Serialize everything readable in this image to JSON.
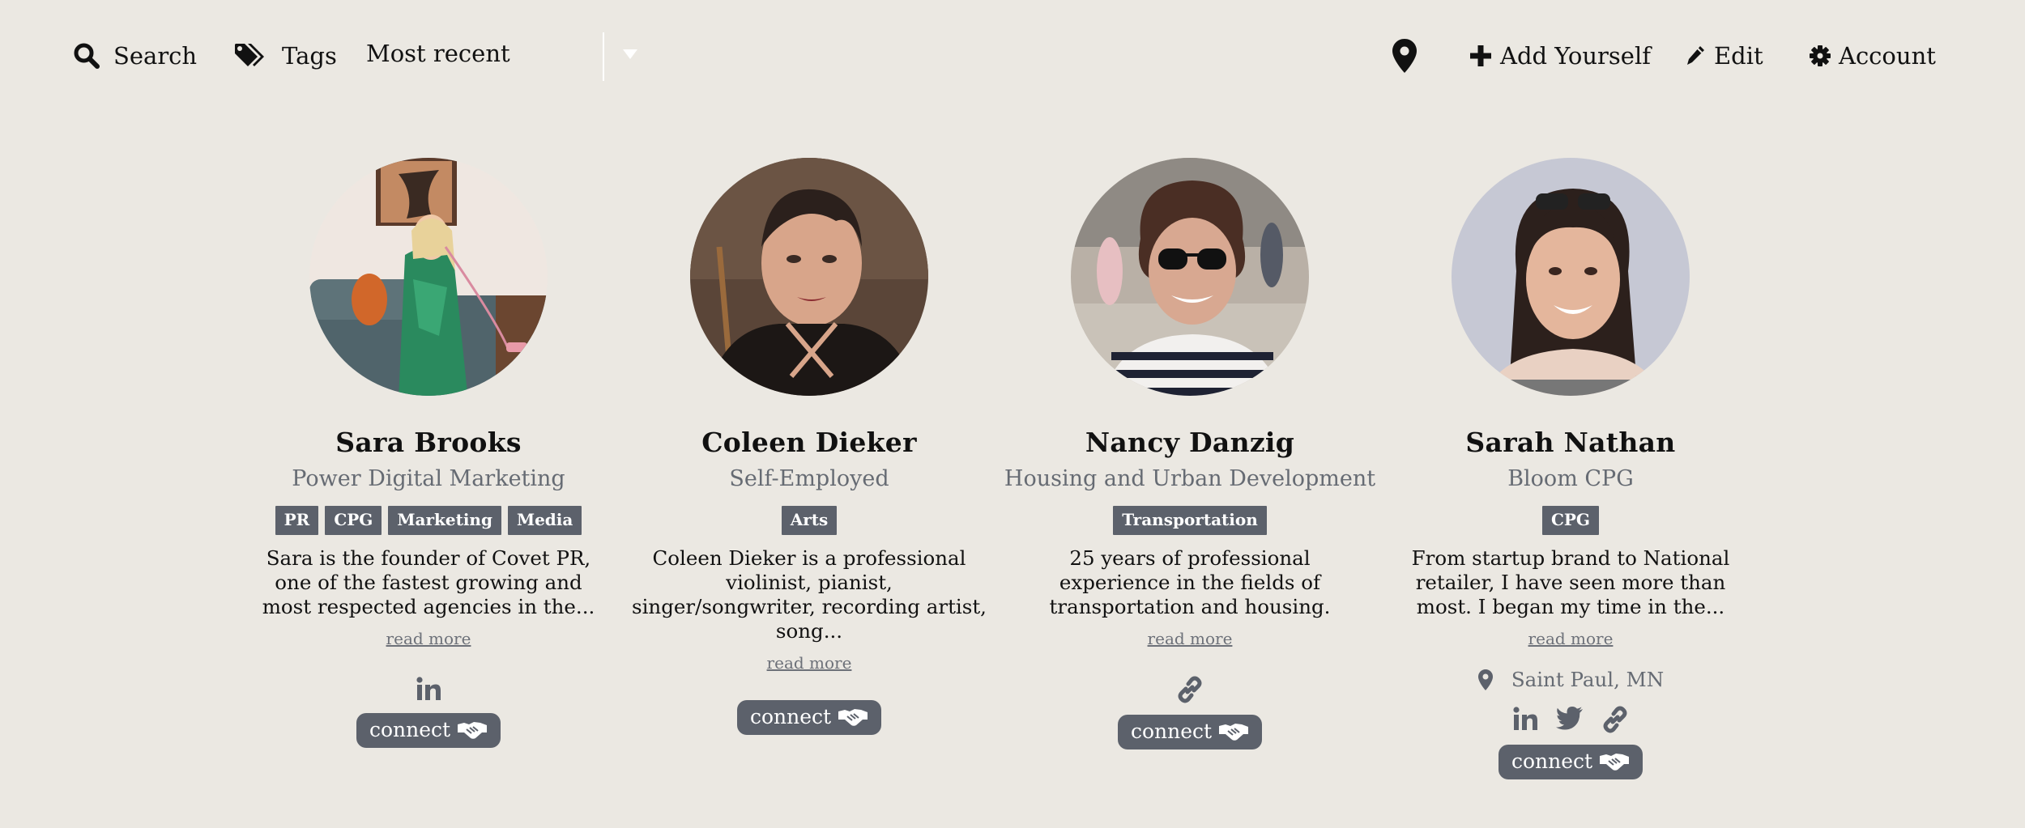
{
  "nav": {
    "search": "Search",
    "tags": "Tags",
    "sort": {
      "selected": "Most recent"
    },
    "location_icon": "map-marker-icon",
    "add_yourself": "Add Yourself",
    "edit": "Edit",
    "account": "Account"
  },
  "colors": {
    "background": "#ebe8e2",
    "badge": "#5c616b",
    "muted_text": "#666b73"
  },
  "profiles": [
    {
      "name": "Sara Brooks",
      "company": "Power Digital Marketing",
      "tags": [
        "PR",
        "CPG",
        "Marketing",
        "Media"
      ],
      "bio": "Sara is the founder of Covet PR, one of the fastest growing and most respected agencies in the...",
      "read_more": "read more",
      "socials": [
        "linkedin-icon"
      ],
      "connect": "connect"
    },
    {
      "name": "Coleen Dieker",
      "company": "Self-Employed",
      "tags": [
        "Arts"
      ],
      "bio": "Coleen Dieker is a professional violinist, pianist, singer/songwriter, recording artist, song...",
      "read_more": "read more",
      "socials": [],
      "connect": "connect"
    },
    {
      "name": "Nancy Danzig",
      "company": "Housing and Urban Development",
      "tags": [
        "Transportation"
      ],
      "bio": "25 years of professional experience in the fields of transportation and housing.",
      "read_more": "read more",
      "socials": [
        "link-icon"
      ],
      "connect": "connect"
    },
    {
      "name": "Sarah Nathan",
      "company": "Bloom CPG",
      "tags": [
        "CPG"
      ],
      "bio": "From startup brand to National retailer, I have seen more than most. I began my time in the...",
      "read_more": "read more",
      "location": "Saint Paul, MN",
      "socials": [
        "linkedin-icon",
        "twitter-icon",
        "link-icon"
      ],
      "connect": "connect"
    }
  ]
}
